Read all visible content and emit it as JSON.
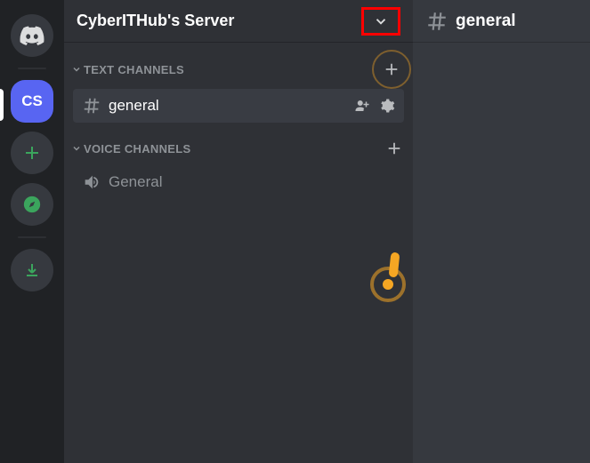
{
  "rail": {
    "selected_server_initials": "CS"
  },
  "server": {
    "name": "CyberITHub's Server"
  },
  "categories": {
    "text": {
      "label": "TEXT CHANNELS"
    },
    "voice": {
      "label": "VOICE CHANNELS"
    }
  },
  "channels": {
    "text_general": "general",
    "voice_general": "General"
  },
  "chat": {
    "current_channel": "general"
  }
}
